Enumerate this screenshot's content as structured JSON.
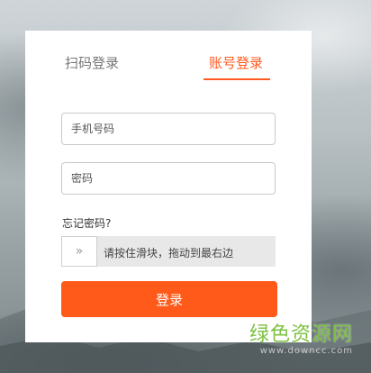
{
  "tabs": {
    "qr_label": "扫码登录",
    "account_label": "账号登录"
  },
  "form": {
    "phone_placeholder": "手机号码",
    "password_placeholder": "密码",
    "forgot_label": "忘记密码?",
    "slider_handle_glyph": "»",
    "slider_hint": "请按住滑块，拖动到最右边",
    "login_label": "登录"
  },
  "watermark": {
    "main": "绿色资源网",
    "url": "www.downcc.com"
  },
  "colors": {
    "accent": "#ff5a1f",
    "watermark": "#7dc142"
  },
  "icons": {
    "slider_handle": "double-chevron-right-icon"
  }
}
